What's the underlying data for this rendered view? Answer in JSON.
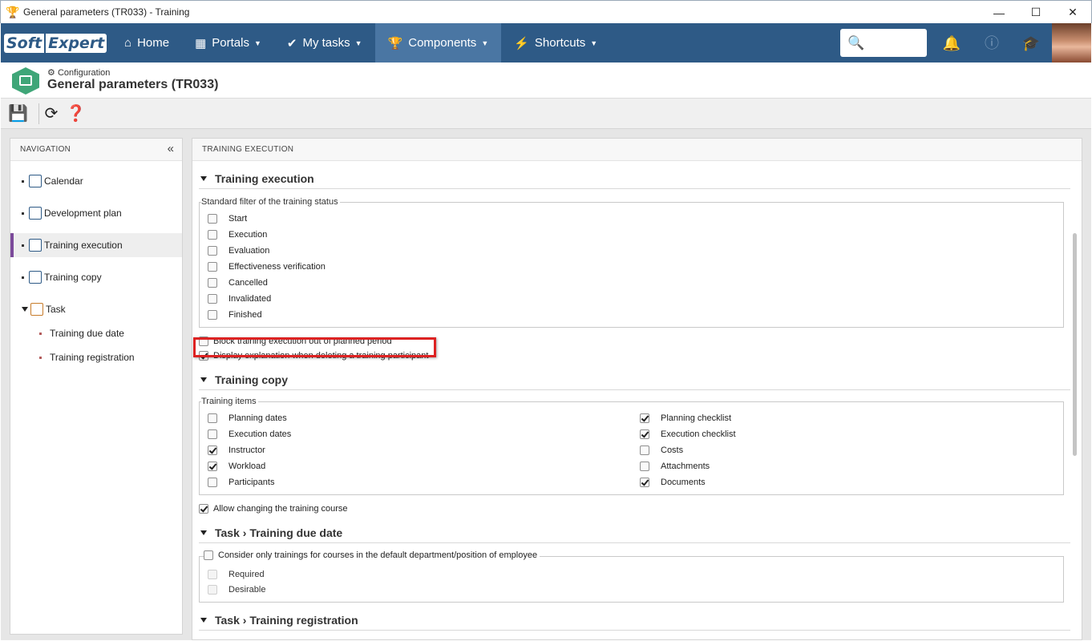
{
  "window": {
    "title": "General parameters (TR033) - Training",
    "minimize": "—",
    "maximize": "☐",
    "close": "✕"
  },
  "appbar": {
    "logo_soft": "Soft",
    "logo_expert": "Expert",
    "nav": [
      {
        "label": "Home",
        "icon": "home-icon",
        "glyph": "⌂"
      },
      {
        "label": "Portals",
        "icon": "grid-icon",
        "glyph": "▦"
      },
      {
        "label": "My tasks",
        "icon": "check-icon",
        "glyph": "✔"
      },
      {
        "label": "Components",
        "icon": "trophy-icon",
        "glyph": "🏆"
      },
      {
        "label": "Shortcuts",
        "icon": "bolt-icon",
        "glyph": "⚡"
      }
    ],
    "search_glyph": "🔍"
  },
  "pagehead": {
    "crumb": "Configuration",
    "title": "General parameters (TR033)"
  },
  "navigation": {
    "header": "NAVIGATION",
    "items": [
      {
        "label": "Calendar"
      },
      {
        "label": "Development plan"
      },
      {
        "label": "Training execution"
      },
      {
        "label": "Training copy"
      },
      {
        "label": "Task"
      }
    ],
    "subitems": [
      {
        "label": "Training due date"
      },
      {
        "label": "Training registration"
      }
    ]
  },
  "main": {
    "header": "TRAINING EXECUTION",
    "sec1": {
      "title": "Training execution",
      "legend": "Standard filter of the training status",
      "statuses": [
        "Start",
        "Execution",
        "Evaluation",
        "Effectiveness verification",
        "Cancelled",
        "Invalidated",
        "Finished"
      ],
      "block_label": "Block training execution out of planned period",
      "display_label": "Display explanation when deleting a training participant"
    },
    "sec2": {
      "title": "Training copy",
      "legend": "Training items",
      "left": [
        "Planning dates",
        "Execution dates",
        "Instructor",
        "Workload",
        "Participants"
      ],
      "right": [
        "Planning checklist",
        "Execution checklist",
        "Costs",
        "Attachments",
        "Documents"
      ],
      "allow_label": "Allow changing the training course"
    },
    "sec3": {
      "title": "Task › Training due date",
      "legend": "Consider only trainings for courses in the default department/position of employee",
      "opts": [
        "Required",
        "Desirable"
      ]
    },
    "sec4": {
      "title": "Task › Training registration"
    }
  }
}
